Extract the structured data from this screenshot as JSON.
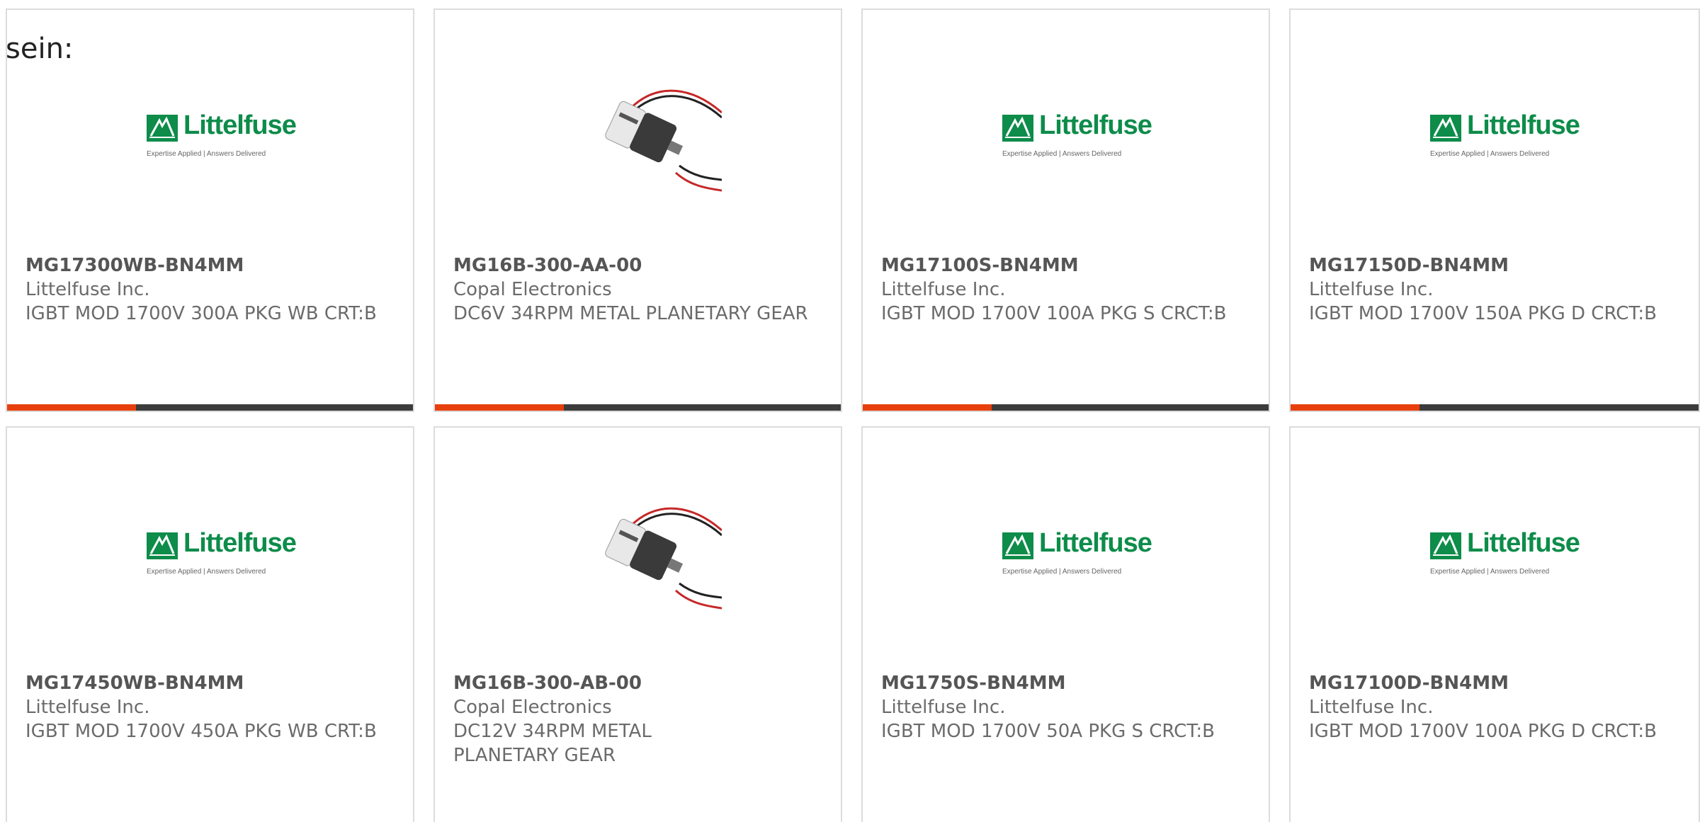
{
  "intro_text": "sein:",
  "brand": {
    "littelfuse_word": "Littelfuse",
    "littelfuse_tagline": "Expertise Applied | Answers Delivered",
    "green": "#0d8c4a",
    "accent": "#e8400c"
  },
  "products": [
    {
      "part": "MG17300WB-BN4MM",
      "manufacturer": "Littelfuse Inc.",
      "description": "IGBT MOD 1700V 300A PKG WB CRT:B",
      "image": "littelfuse-logo"
    },
    {
      "part": "MG16B-300-AA-00",
      "manufacturer": "Copal Electronics",
      "description": "DC6V 34RPM METAL PLANETARY GEAR",
      "image": "gear-motor-photo"
    },
    {
      "part": "MG17100S-BN4MM",
      "manufacturer": "Littelfuse Inc.",
      "description": "IGBT MOD 1700V 100A PKG S CRCT:B",
      "image": "littelfuse-logo"
    },
    {
      "part": "MG17150D-BN4MM",
      "manufacturer": "Littelfuse Inc.",
      "description": "IGBT MOD 1700V 150A PKG D CRCT:B",
      "image": "littelfuse-logo"
    },
    {
      "part": "MG17450WB-BN4MM",
      "manufacturer": "Littelfuse Inc.",
      "description": "IGBT MOD 1700V 450A PKG WB CRT:B",
      "image": "littelfuse-logo"
    },
    {
      "part": "MG16B-300-AB-00",
      "manufacturer": "Copal Electronics",
      "description": "DC12V 34RPM METAL PLANETARY GEAR",
      "image": "gear-motor-photo"
    },
    {
      "part": "MG1750S-BN4MM",
      "manufacturer": "Littelfuse Inc.",
      "description": "IGBT MOD 1700V 50A PKG S CRCT:B",
      "image": "littelfuse-logo"
    },
    {
      "part": "MG17100D-BN4MM",
      "manufacturer": "Littelfuse Inc.",
      "description": "IGBT MOD 1700V 100A PKG D CRCT:B",
      "image": "littelfuse-logo"
    }
  ]
}
